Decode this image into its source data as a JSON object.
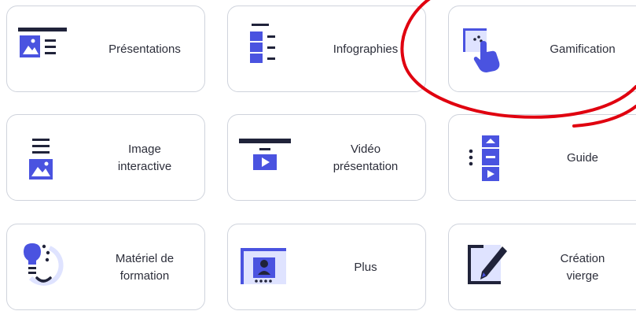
{
  "colors": {
    "accent": "#4a53e0",
    "dark": "#20233a",
    "card_border": "#cfd3dc",
    "annotation_red": "#e0000f"
  },
  "cards": [
    {
      "id": "presentations",
      "icon": "presentation-icon",
      "lines": [
        "Présentations"
      ]
    },
    {
      "id": "infographics",
      "icon": "infographic-icon",
      "lines": [
        "Infographies"
      ]
    },
    {
      "id": "gamification",
      "icon": "tap-hand-icon",
      "lines": [
        "Gamification"
      ]
    },
    {
      "id": "interactive-image",
      "icon": "interactive-image-icon",
      "lines": [
        "Image",
        "interactive"
      ]
    },
    {
      "id": "video-presentation",
      "icon": "video-presentation-icon",
      "lines": [
        "Vidéo",
        "présentation"
      ]
    },
    {
      "id": "guide",
      "icon": "guide-icon",
      "lines": [
        "Guide"
      ]
    },
    {
      "id": "training-material",
      "icon": "lightbulb-icon",
      "lines": [
        "Matériel de",
        "formation"
      ]
    },
    {
      "id": "more",
      "icon": "more-icon",
      "lines": [
        "Plus"
      ]
    },
    {
      "id": "blank-creation",
      "icon": "pencil-icon",
      "lines": [
        "Création",
        "vierge"
      ]
    }
  ]
}
